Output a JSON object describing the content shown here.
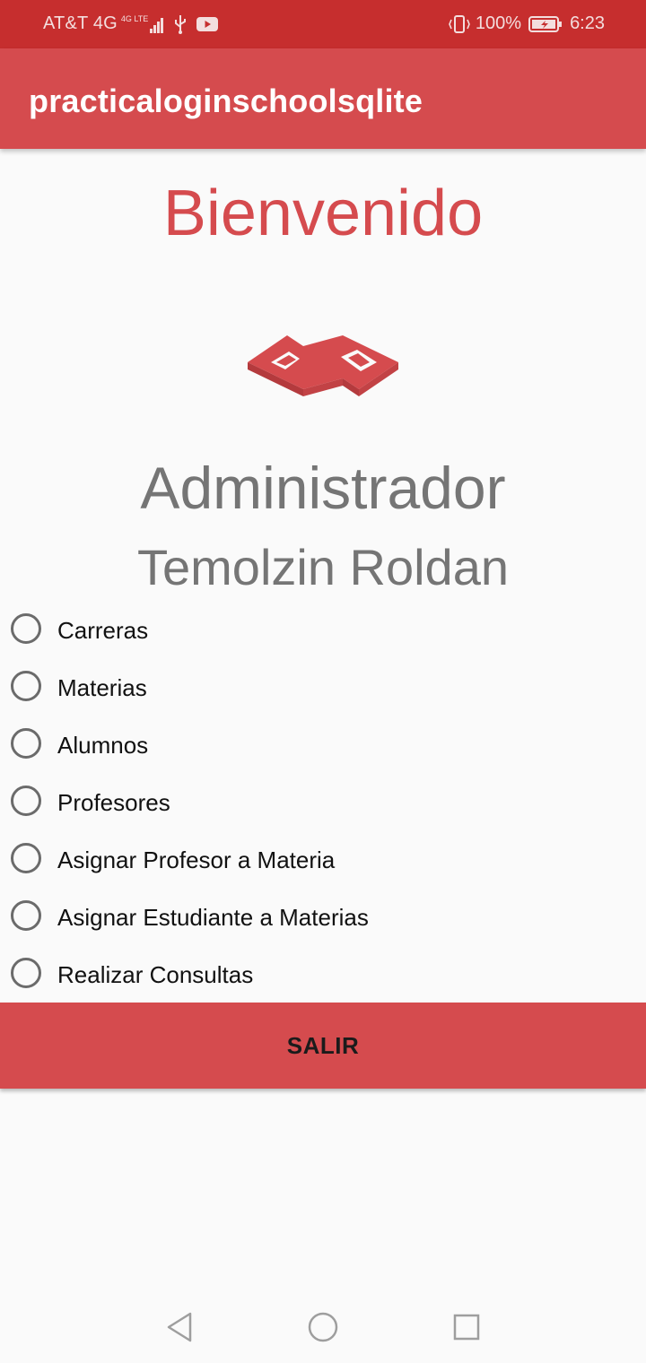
{
  "status_bar": {
    "carrier": "AT&T 4G",
    "network_small": "4G LTE",
    "battery": "100%",
    "time": "6:23",
    "icons": [
      "signal-icon",
      "usb-icon",
      "youtube-icon",
      "vibrate-icon",
      "battery-icon"
    ]
  },
  "app_bar": {
    "title": "practicaloginschoolsqlite"
  },
  "main": {
    "welcome": "Bienvenido",
    "role": "Administrador",
    "user_name": "Temolzin Roldan",
    "options": [
      {
        "label": "Carreras",
        "checked": false
      },
      {
        "label": "Materias",
        "checked": false
      },
      {
        "label": "Alumnos",
        "checked": false
      },
      {
        "label": "Profesores",
        "checked": false
      },
      {
        "label": "Asignar Profesor a Materia",
        "checked": false
      },
      {
        "label": "Asignar Estudiante a Materias",
        "checked": false
      },
      {
        "label": "Realizar Consultas",
        "checked": false
      }
    ],
    "exit_label": "SALIR"
  },
  "nav_bar": {
    "icons": [
      "back-icon",
      "home-icon",
      "recents-icon"
    ]
  },
  "colors": {
    "primary": "#d54b4e",
    "status_bar": "#c62e2e",
    "text_secondary": "#757575"
  }
}
